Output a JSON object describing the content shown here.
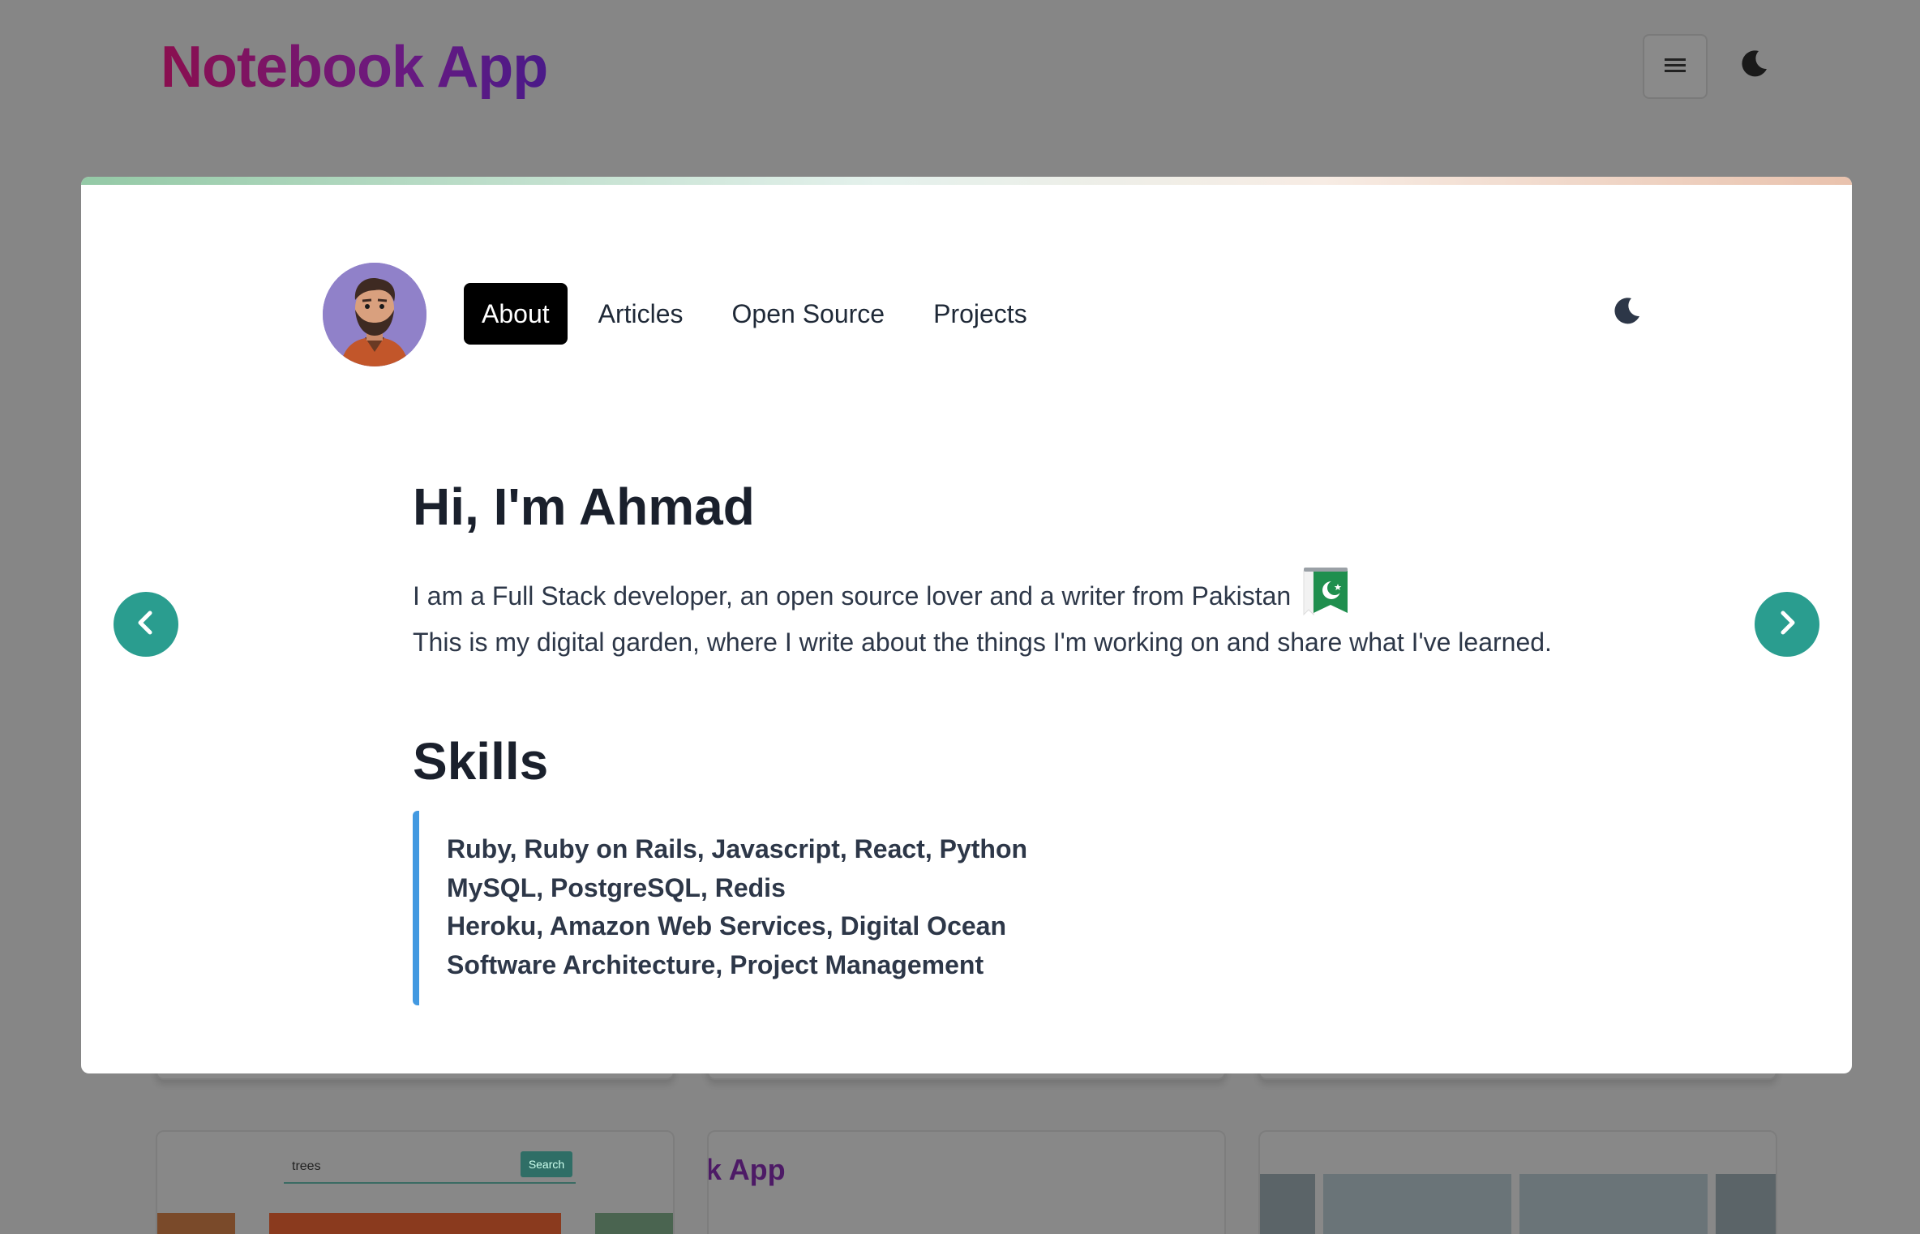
{
  "header": {
    "title": "Notebook App",
    "menu_icon": "hamburger-menu-icon",
    "theme_icon": "moon-icon"
  },
  "modal": {
    "nav": {
      "items": [
        {
          "label": "About",
          "active": true
        },
        {
          "label": "Articles",
          "active": false
        },
        {
          "label": "Open Source",
          "active": false
        },
        {
          "label": "Projects",
          "active": false
        }
      ],
      "theme_icon": "moon-icon"
    },
    "hero": {
      "title": "Hi, I'm Ahmad",
      "line1": "I am a Full Stack developer, an open source lover and a writer from Pakistan",
      "line2": "This is my digital garden, where I write about the things I'm working on and share what I've learned.",
      "flag_icon": "pakistan-flag-icon"
    },
    "skills": {
      "title": "Skills",
      "lines": [
        "Ruby, Ruby on Rails, Javascript, React, Python",
        "MySQL, PostgreSQL, Redis",
        "Heroku, Amazon Web Services, Digital Ocean",
        "Software Architecture, Project Management"
      ]
    },
    "arrows": {
      "prev_icon": "chevron-left-icon",
      "next_icon": "chevron-right-icon"
    }
  },
  "background_cards": {
    "card1": {
      "search_value": "trees",
      "search_button": "Search"
    },
    "card2": {
      "title_fragment": "k App"
    }
  },
  "colors": {
    "accent_teal": "#2a9d8f",
    "quote_border": "#4299e1",
    "overlay_bg": "#868686",
    "title_gradient_start": "#8a0f4f",
    "title_gradient_end": "#4a1a88"
  }
}
